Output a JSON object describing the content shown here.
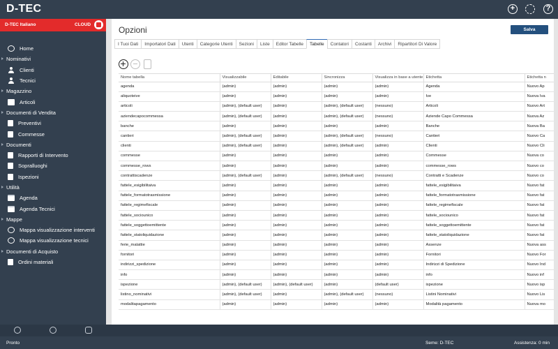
{
  "app": {
    "title": "D-TEC"
  },
  "brand": {
    "company": "D-TEC Italiano",
    "cloud_label": "CLOUD"
  },
  "sidebar": {
    "items": [
      {
        "type": "group",
        "label": "",
        "icon": "globe-icon"
      },
      {
        "type": "item",
        "label": "Home",
        "icon": "globe-icon"
      },
      {
        "type": "group",
        "label": "Nominativi"
      },
      {
        "type": "item",
        "label": "Clienti",
        "icon": "person-icon"
      },
      {
        "type": "item",
        "label": "Tecnici",
        "icon": "person-icon"
      },
      {
        "type": "group",
        "label": "Magazzino"
      },
      {
        "type": "item",
        "label": "Articoli",
        "icon": "box-icon"
      },
      {
        "type": "group",
        "label": "Documenti di Vendita"
      },
      {
        "type": "item",
        "label": "Preventivi",
        "icon": "document-icon"
      },
      {
        "type": "item",
        "label": "Commesse",
        "icon": "document-icon"
      },
      {
        "type": "group",
        "label": "Documenti"
      },
      {
        "type": "item",
        "label": "Rapporti di Intervento",
        "icon": "document-icon"
      },
      {
        "type": "item",
        "label": "Sopralluoghi",
        "icon": "document-icon"
      },
      {
        "type": "item",
        "label": "Ispezioni",
        "icon": "document-icon"
      },
      {
        "type": "group",
        "label": "Utilità"
      },
      {
        "type": "item",
        "label": "Agenda",
        "icon": "calendar-icon"
      },
      {
        "type": "item",
        "label": "Agenda Tecnici",
        "icon": "calendar-icon"
      },
      {
        "type": "group",
        "label": "Mappe"
      },
      {
        "type": "item",
        "label": "Mappa visualizzazione interventi",
        "icon": "globe-icon"
      },
      {
        "type": "item",
        "label": "Mappa visualizzazione tecnici",
        "icon": "globe-icon"
      },
      {
        "type": "group",
        "label": "Documenti di Acquisto"
      },
      {
        "type": "item",
        "label": "Ordini materiali",
        "icon": "document-icon"
      }
    ]
  },
  "page": {
    "title": "Opzioni",
    "save_label": "Salva",
    "tabs": [
      "I Tuoi Dati",
      "Importatori Dati",
      "Utenti",
      "Categorie Utenti",
      "Sezioni",
      "Liste",
      "Editor Tabelle",
      "Tabelle",
      "Contatori",
      "Costanti",
      "Archivi",
      "Ripartitori Di Valore"
    ],
    "active_tab": "Tabelle"
  },
  "table": {
    "columns": [
      "Nome tabella",
      "Visualizzabile",
      "Editabile",
      "Sincronizza",
      "Visualizza in base a utente",
      "Etichetta",
      "Etichetta n"
    ],
    "rows": [
      [
        "agenda",
        "(admin)",
        "(admin)",
        "(admin)",
        "(admin)",
        "Agenda",
        "Nuovo Ap"
      ],
      [
        "aliquoteive",
        "(admin)",
        "(admin)",
        "(admin)",
        "(admin)",
        "Ive",
        "Nuova Iva"
      ],
      [
        "articoli",
        "(admin), (default user)",
        "(admin)",
        "(admin), (default user)",
        "(nessuno)",
        "Articoli",
        "Nuovo Art"
      ],
      [
        "aziendecapocommessa",
        "(admin), (default user)",
        "(admin)",
        "(admin), (default user)",
        "(nessuno)",
        "Aziende Capo Commessa",
        "Nuova Az"
      ],
      [
        "banche",
        "(admin)",
        "(admin)",
        "(admin)",
        "(admin)",
        "Banche",
        "Nuova Ba"
      ],
      [
        "cantieri",
        "(admin), (default user)",
        "(admin)",
        "(admin), (default user)",
        "(nessuno)",
        "Cantieri",
        "Nuovo Ca"
      ],
      [
        "clienti",
        "(admin), (default user)",
        "(admin)",
        "(admin), (default user)",
        "(admin)",
        "Clienti",
        "Nuovo Cli"
      ],
      [
        "commesse",
        "(admin)",
        "(admin)",
        "(admin)",
        "(admin)",
        "Commesse",
        "Nuova co"
      ],
      [
        "commesse_rows",
        "(admin)",
        "(admin)",
        "(admin)",
        "(admin)",
        "commesse_rows",
        "Nuovo co"
      ],
      [
        "contrattiscadenze",
        "(admin), (default user)",
        "(admin)",
        "(admin), (default user)",
        "(nessuno)",
        "Contratti e Scadenze",
        "Nuovo co"
      ],
      [
        "fattele_esigibilitaiva",
        "(admin)",
        "(admin)",
        "(admin)",
        "(admin)",
        "fattele_esigibilitaiva",
        "Nuovo fat"
      ],
      [
        "fattele_formatotrasmissione",
        "(admin)",
        "(admin)",
        "(admin)",
        "(admin)",
        "fattele_formatotrasmissione",
        "Nuovo fat"
      ],
      [
        "fattele_regimefiscale",
        "(admin)",
        "(admin)",
        "(admin)",
        "(admin)",
        "fattele_regimefiscale",
        "Nuovo fat"
      ],
      [
        "fattele_sociounico",
        "(admin)",
        "(admin)",
        "(admin)",
        "(admin)",
        "fattele_sociounico",
        "Nuovo fat"
      ],
      [
        "fattele_soggettoemittente",
        "(admin)",
        "(admin)",
        "(admin)",
        "(admin)",
        "fattele_soggettoemittente",
        "Nuovo fat"
      ],
      [
        "fattele_statoliquidazione",
        "(admin)",
        "(admin)",
        "(admin)",
        "(admin)",
        "fattele_statoliquidazione",
        "Nuovo fat"
      ],
      [
        "ferie_malattie",
        "(admin)",
        "(admin)",
        "(admin)",
        "(admin)",
        "Assenze",
        "Nuova ass"
      ],
      [
        "fornitori",
        "(admin)",
        "(admin)",
        "(admin)",
        "(admin)",
        "Fornitori",
        "Nuovo For"
      ],
      [
        "indirizzi_spedizione",
        "(admin)",
        "(admin)",
        "(admin)",
        "(admin)",
        "Indirizzi di Spedizione",
        "Nuovo Ind"
      ],
      [
        "info",
        "(admin)",
        "(admin)",
        "(admin)",
        "(admin)",
        "info",
        "Nuovo inf"
      ],
      [
        "ispezione",
        "(admin), (default user)",
        "(admin), (default user)",
        "(admin)",
        "(default user)",
        "ispezione",
        "Nuovo isp"
      ],
      [
        "listino_nominativi",
        "(admin), (default user)",
        "(admin)",
        "(admin), (default user)",
        "(nessuno)",
        "Listini Nominativi",
        "Nuovo Lis"
      ],
      [
        "modalitapagamento",
        "(admin)",
        "(admin)",
        "(admin)",
        "(admin)",
        "Modalità pagamento",
        "Nuova mo"
      ]
    ]
  },
  "status": {
    "left": "Pronto",
    "seme": "Seme: D-TEC",
    "assistenza": "Assistenza: 0 min"
  }
}
